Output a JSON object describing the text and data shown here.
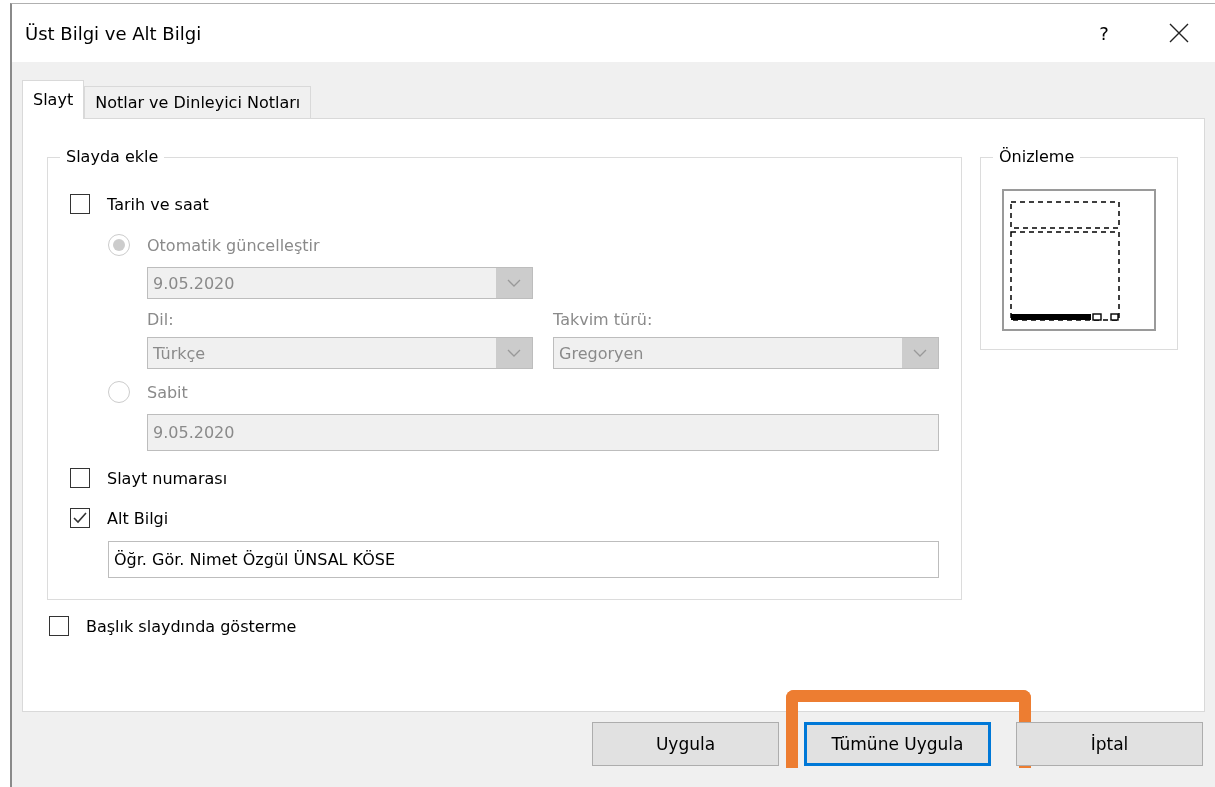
{
  "window": {
    "title": "Üst Bilgi ve Alt Bilgi",
    "help": "?"
  },
  "tabs": [
    {
      "label": "Slayt",
      "selected": true
    },
    {
      "label": "Notlar ve Dinleyici Notları",
      "selected": false
    }
  ],
  "slide_group": {
    "title": "Slayda ekle",
    "date_time": {
      "label": "Tarih ve saat",
      "checked": false
    },
    "auto_update": {
      "label": "Otomatik güncelleştir",
      "selected": true,
      "disabled": true
    },
    "auto_date": {
      "value": "9.05.2020",
      "disabled": true
    },
    "language": {
      "label": "Dil:",
      "value": "Türkçe",
      "disabled": true
    },
    "calendar": {
      "label": "Takvim türü:",
      "value": "Gregoryen",
      "disabled": true
    },
    "fixed": {
      "label": "Sabit",
      "selected": false,
      "disabled": true
    },
    "fixed_date": {
      "value": "9.05.2020",
      "disabled": true
    },
    "slide_number": {
      "label": "Slayt numarası",
      "checked": false
    },
    "footer": {
      "label": "Alt Bilgi",
      "checked": true
    },
    "footer_text": {
      "value": "Öğr. Gör. Nimet Özgül ÜNSAL KÖSE"
    }
  },
  "dont_show_on_title": {
    "label": "Başlık slaydında gösterme",
    "checked": false
  },
  "preview": {
    "title": "Önizleme"
  },
  "buttons": [
    {
      "label": "Uygula",
      "default": false,
      "highlighted": false
    },
    {
      "label": "Tümüne Uygula",
      "default": true,
      "highlighted": true
    },
    {
      "label": "İptal",
      "default": false,
      "highlighted": false
    }
  ]
}
